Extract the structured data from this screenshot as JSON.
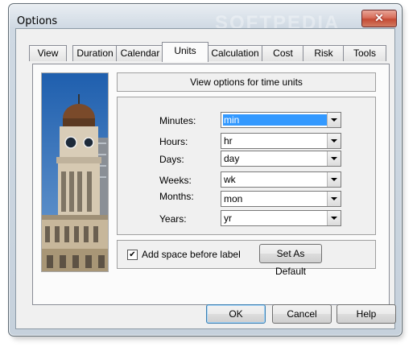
{
  "window": {
    "title": "Options",
    "close_glyph": "✕"
  },
  "watermark": "SOFTPEDIA",
  "tabs": [
    {
      "label": "View"
    },
    {
      "label": "Duration"
    },
    {
      "label": "Calendar"
    },
    {
      "label": "Units",
      "active": true
    },
    {
      "label": "Calculation"
    },
    {
      "label": "Cost"
    },
    {
      "label": "Risk"
    },
    {
      "label": "Tools"
    }
  ],
  "panel": {
    "header": "View options for time units",
    "units": [
      {
        "label": "Minutes:",
        "value": "min",
        "selected": true
      },
      {
        "label": "Hours:",
        "value": "hr"
      },
      {
        "label": "Days:",
        "value": "day"
      },
      {
        "label": "Weeks:",
        "value": "wk"
      },
      {
        "label": "Months:",
        "value": "mon"
      },
      {
        "label": "Years:",
        "value": "yr"
      }
    ],
    "add_space": {
      "label": "Add space before label",
      "checked": true,
      "check_glyph": "✔"
    },
    "set_default_label": "Set As Default"
  },
  "buttons": {
    "ok": "OK",
    "cancel": "Cancel",
    "help": "Help"
  }
}
